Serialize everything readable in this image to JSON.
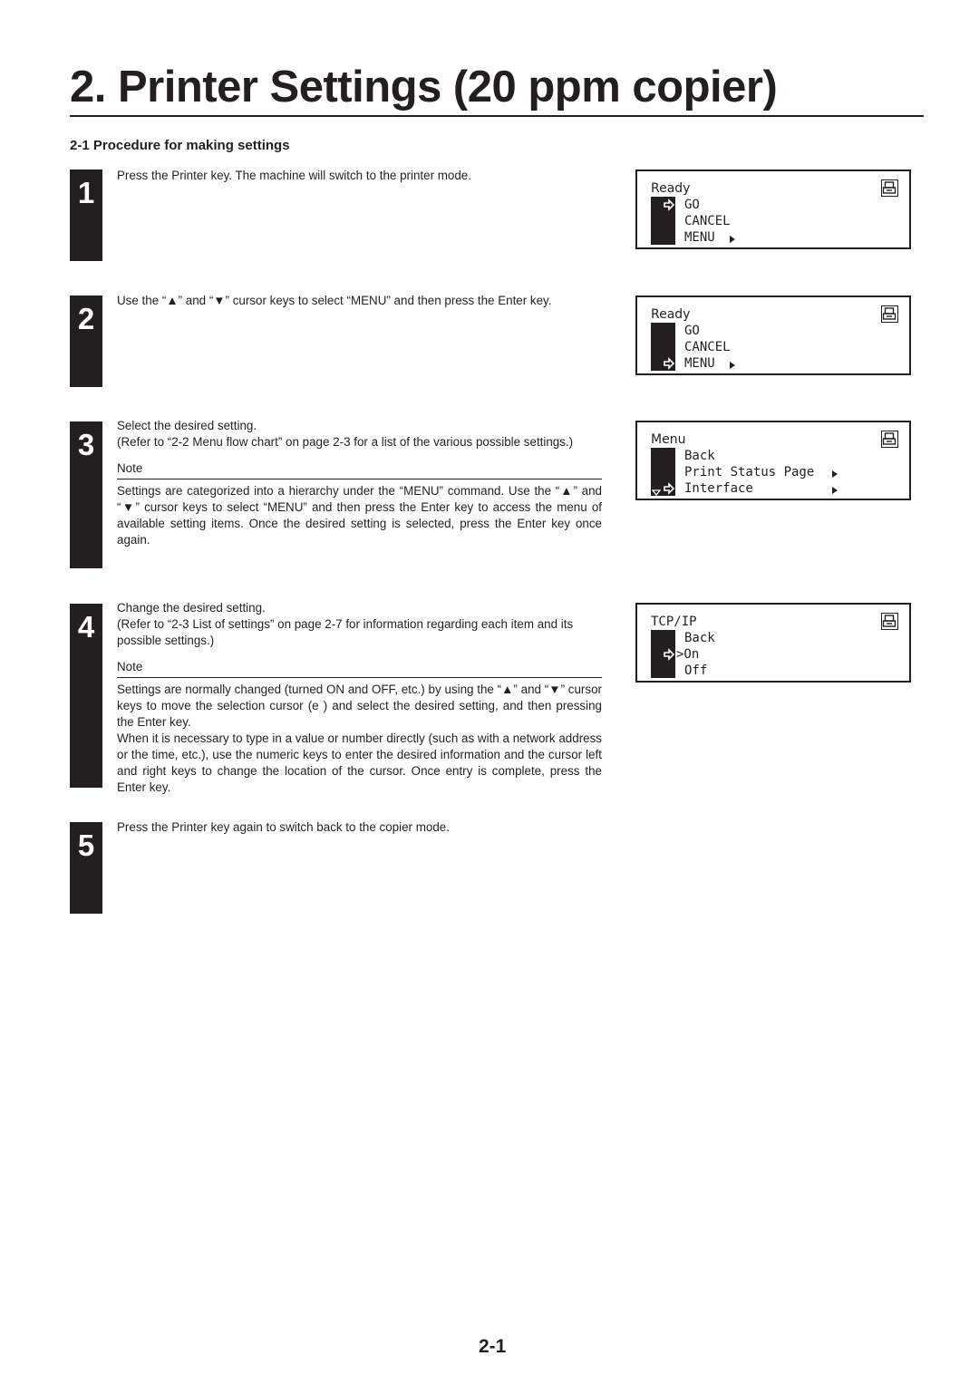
{
  "page": {
    "title": "2. Printer Settings (20 ppm copier)",
    "section_heading": "2-1 Procedure for making settings",
    "page_number": "2-1"
  },
  "steps": [
    {
      "number": "1",
      "text": "Press the Printer key. The machine will switch to the printer mode."
    },
    {
      "number": "2",
      "text": "Use the “▲” and “▼” cursor keys to select “MENU” and then press the Enter key."
    },
    {
      "number": "3",
      "text": "Select the desired setting.",
      "reference": "(Refer to “2-2  Menu flow chart” on page 2-3 for a list of the various possible settings.)",
      "note_label": "Note",
      "note_body": "Settings are categorized into a hierarchy under the “MENU” command. Use the “▲” and “▼” cursor keys to select “MENU” and then press the Enter key to access the menu of available setting items. Once the desired setting is selected, press the Enter key once again."
    },
    {
      "number": "4",
      "text": "Change the desired setting.",
      "reference": "(Refer to “2-3  List of settings” on page 2-7 for information regarding each item and its possible settings.)",
      "note_label": "Note",
      "note_body_1": "Settings are normally changed (turned ON and OFF, etc.) by using the “▲” and “▼” cursor keys to move the selection cursor (e  ) and select the desired setting, and then pressing the Enter key.",
      "note_body_2": "When it is necessary to type in a value or number directly (such as with a network address or the time, etc.), use the numeric keys to enter the desired information and the cursor left and right keys to change the location of the cursor. Once entry is complete, press the Enter key."
    },
    {
      "number": "5",
      "text": "Press the Printer key again to switch back to the copier mode."
    }
  ],
  "displays": [
    {
      "title": "Ready",
      "lines": [
        "GO",
        "CANCEL",
        "MENU"
      ],
      "cursor_line": 1,
      "submenu_lines": [
        3
      ]
    },
    {
      "title": "Ready",
      "lines": [
        "GO",
        "CANCEL",
        "MENU"
      ],
      "cursor_line": 3,
      "submenu_lines": [
        3
      ]
    },
    {
      "title": "Menu",
      "lines": [
        "Back",
        "Print Status Page",
        "Interface"
      ],
      "cursor_line": 3,
      "submenu_lines": [
        2,
        3
      ],
      "scroll_indicator": "down"
    },
    {
      "title": "TCP/IP",
      "lines": [
        "Back",
        ">On",
        "Off"
      ],
      "cursor_line": 2,
      "submenu_lines": []
    }
  ]
}
